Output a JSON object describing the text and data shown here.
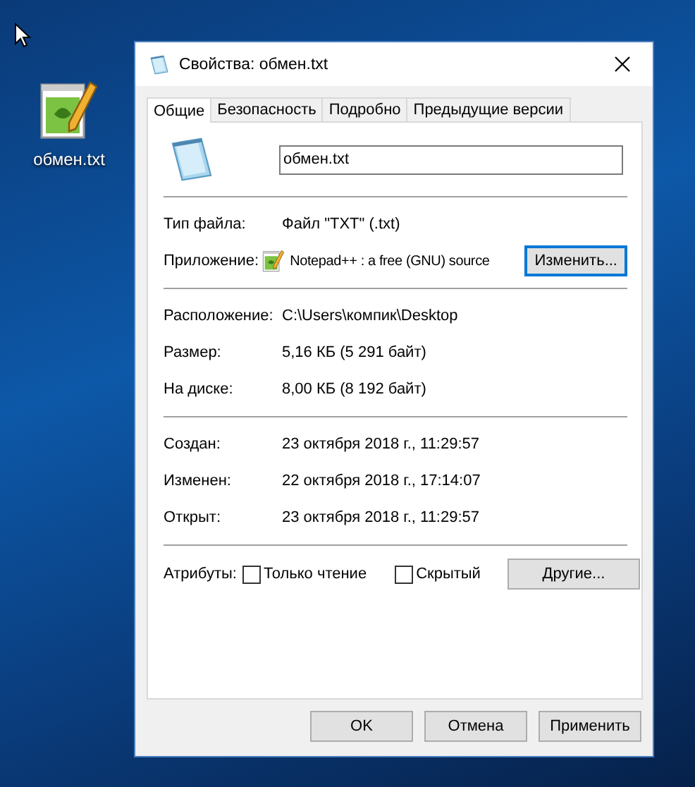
{
  "desktop_icon": {
    "label": "обмен.txt"
  },
  "window": {
    "title": "Свойства: обмен.txt"
  },
  "tabs": [
    {
      "label": "Общие",
      "selected": true
    },
    {
      "label": "Безопасность",
      "selected": false
    },
    {
      "label": "Подробно",
      "selected": false
    },
    {
      "label": "Предыдущие версии",
      "selected": false
    }
  ],
  "file_name": "обмен.txt",
  "sections": [
    [
      {
        "kind": "text",
        "label": "Тип файла:",
        "value": "Файл \"TXT\" (.txt)"
      },
      {
        "kind": "app",
        "label": "Приложение:",
        "value": "Notepad++ : a free (GNU) source",
        "button": "Изменить..."
      }
    ],
    [
      {
        "kind": "text",
        "label": "Расположение:",
        "value": "C:\\Users\\компик\\Desktop"
      },
      {
        "kind": "text",
        "label": "Размер:",
        "value": "5,16 КБ (5 291 байт)"
      },
      {
        "kind": "text",
        "label": "На диске:",
        "value": "8,00 КБ (8 192 байт)"
      }
    ],
    [
      {
        "kind": "text",
        "label": "Создан:",
        "value": "23 октября 2018 г., 11:29:57"
      },
      {
        "kind": "text",
        "label": "Изменен:",
        "value": "22 октября 2018 г., 17:14:07"
      },
      {
        "kind": "text",
        "label": "Открыт:",
        "value": "23 октября 2018 г., 11:29:57"
      }
    ]
  ],
  "attributes": {
    "label": "Атрибуты:",
    "checkboxes": [
      {
        "label": "Только чтение",
        "checked": false
      },
      {
        "label": "Скрытый",
        "checked": false
      }
    ],
    "button": "Другие..."
  },
  "buttons": [
    {
      "label": "OK"
    },
    {
      "label": "Отмена"
    },
    {
      "label": "Применить"
    }
  ]
}
